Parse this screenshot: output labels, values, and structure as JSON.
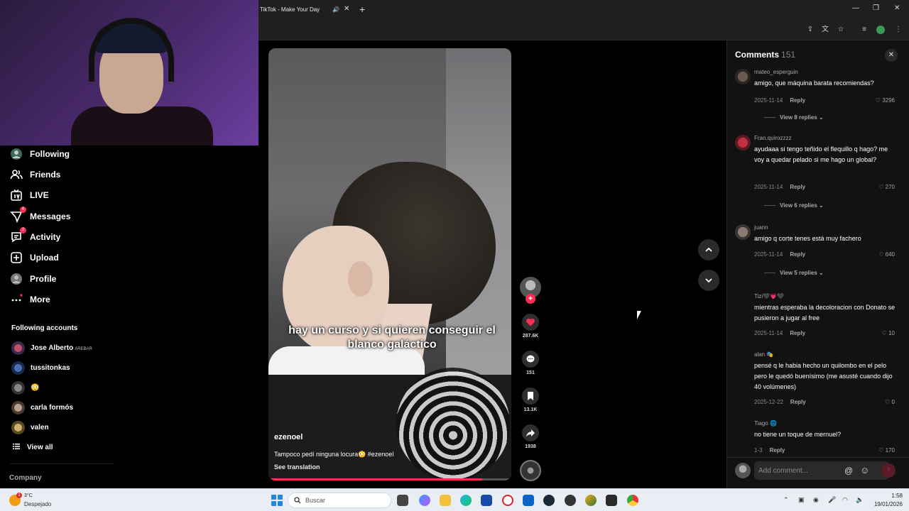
{
  "browser": {
    "tab_title": "TikTok - Make Your Day"
  },
  "sidebar": {
    "items": [
      {
        "label": "Following",
        "icon": "following-icon"
      },
      {
        "label": "Friends",
        "icon": "friends-icon"
      },
      {
        "label": "LIVE",
        "icon": "live-icon"
      },
      {
        "label": "Messages",
        "icon": "messages-icon",
        "badge": "6"
      },
      {
        "label": "Activity",
        "icon": "activity-icon",
        "badge": "2"
      },
      {
        "label": "Upload",
        "icon": "upload-icon"
      },
      {
        "label": "Profile",
        "icon": "profile-icon"
      },
      {
        "label": "More",
        "icon": "more-icon"
      }
    ],
    "following_title": "Following accounts",
    "accounts": [
      {
        "name": "Jose Alberto",
        "sub": "AREBAR"
      },
      {
        "name": "tussitonkas",
        "sub": ""
      },
      {
        "name": "😳",
        "sub": ""
      },
      {
        "name": "carla formós",
        "sub": ""
      },
      {
        "name": "valen",
        "sub": ""
      }
    ],
    "view_all": "View all",
    "company": "Company"
  },
  "video": {
    "caption": "hay un curso y si quieren conseguir el blanco galáctico",
    "author": "ezenoel",
    "description": "Tampoco pedí ninguna locura😳 #ezenoel",
    "see_translation": "See translation",
    "progress": 0.88
  },
  "actions": {
    "likes": "287.6K",
    "comments": "151",
    "saves": "13.1K",
    "shares": "1938"
  },
  "comments": {
    "title": "Comments",
    "count": "151",
    "placeholder": "Add comment...",
    "items": [
      {
        "user": "mateo_esperguin",
        "text": "amigo, que máquina barata recomiendas?",
        "date": "2025-11-14",
        "reply": "Reply",
        "likes": "3296",
        "view_replies": "View 8 replies"
      },
      {
        "user": "Fran.quirozzzz",
        "text": "ayudaaa si tengo teñido el flequillo q hago? me voy a quedar pelado si me hago un global?",
        "date": "2025-11-14",
        "reply": "Reply",
        "likes": "270",
        "view_replies": "View 6 replies"
      },
      {
        "user": "juann",
        "text": "amigo q corte tenes está muy fachero",
        "date": "2025-11-14",
        "reply": "Reply",
        "likes": "640",
        "view_replies": "View 5 replies"
      },
      {
        "user": "Tizi🖤💗🖤",
        "text": "mientras esperaba la decoloracion con Donato se pusieron a jugar al free",
        "date": "2025-11-14",
        "reply": "Reply",
        "likes": "10"
      },
      {
        "user": "alan 🎭",
        "text": "pensé q le habia hecho un quilombo en el pelo pero le quedó buenísimo (me asusté cuando dijo 40 volúmenes)",
        "date": "2025-12-22",
        "reply": "Reply",
        "likes": "0"
      },
      {
        "user": "Tiago 🌐",
        "text": "no tiene un toque de mernuel?",
        "date": "1-3",
        "reply": "Reply",
        "likes": "170"
      }
    ]
  },
  "taskbar": {
    "weather_temp": "3°C",
    "weather_status": "Despejado",
    "weather_badge": "1",
    "search_placeholder": "Buscar",
    "time": "1:58",
    "date": "19/01/2026"
  },
  "colors": {
    "accent": "#fe2c55",
    "panel_bg": "#121212",
    "taskbar_bg": "#e9eef4"
  }
}
